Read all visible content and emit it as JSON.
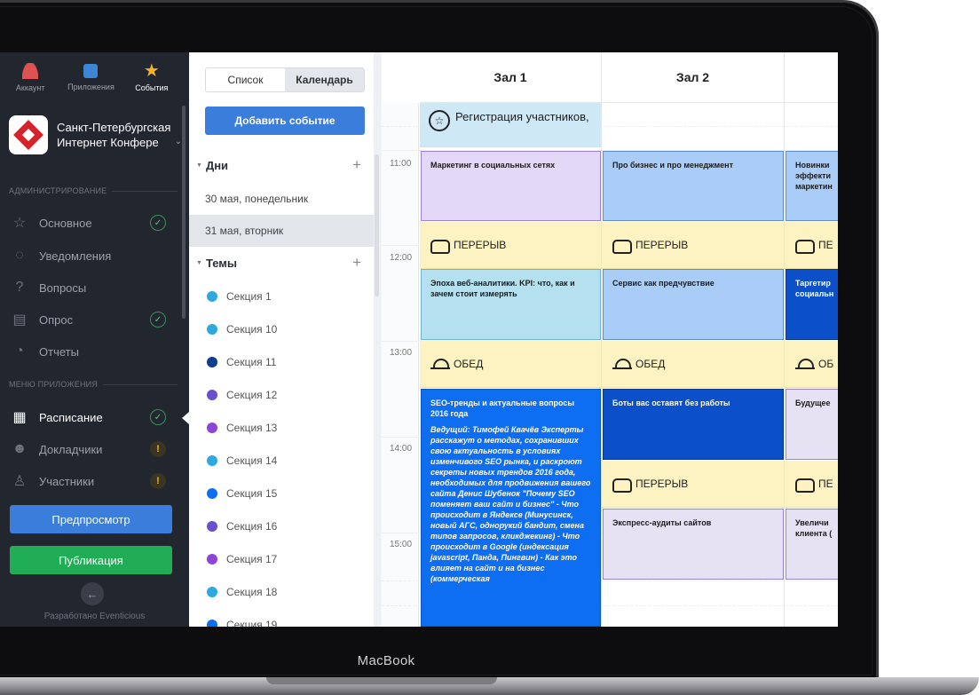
{
  "app": {
    "top_tabs": [
      {
        "label": "Аккаунт",
        "icon": "user-icon"
      },
      {
        "label": "Приложения",
        "icon": "apps-icon"
      },
      {
        "label": "События",
        "icon": "star-icon"
      }
    ],
    "org_name": "Санкт-Петербургская Интернет Конфере",
    "admin_section": "АДМИНИСТРИРОВАНИЕ",
    "admin_items": [
      {
        "label": "Основное",
        "icon": "star-outline-icon",
        "status": "ok"
      },
      {
        "label": "Уведомления",
        "icon": "chat-icon",
        "status": ""
      },
      {
        "label": "Вопросы",
        "icon": "question-icon",
        "status": ""
      },
      {
        "label": "Опрос",
        "icon": "survey-icon",
        "status": "ok"
      },
      {
        "label": "Отчеты",
        "icon": "reports-icon",
        "status": ""
      }
    ],
    "menu_section": "МЕНЮ ПРИЛОЖЕНИЯ",
    "menu_items": [
      {
        "label": "Расписание",
        "icon": "calendar-icon",
        "status": "ok"
      },
      {
        "label": "Докладчики",
        "icon": "speaker-icon",
        "status": "warn"
      },
      {
        "label": "Участники",
        "icon": "participants-icon",
        "status": "warn"
      }
    ],
    "preview_button": "Предпросмотр",
    "publish_button": "Публикация",
    "credit": "Разработано Eventicious",
    "check_glyph": "✓",
    "warn_glyph": "!"
  },
  "panel": {
    "view_list": "Список",
    "view_calendar": "Календарь",
    "add_event": "Добавить событие",
    "days_header": "Дни",
    "days": [
      "30 мая, понедельник",
      "31 мая, вторник"
    ],
    "themes_header": "Темы",
    "themes": [
      {
        "label": "Секция 1",
        "color": "#2ea8e0"
      },
      {
        "label": "Секция 10",
        "color": "#2ea8e0"
      },
      {
        "label": "Секция 11",
        "color": "#0b3d91"
      },
      {
        "label": "Секция 12",
        "color": "#6b4fd1"
      },
      {
        "label": "Секция 13",
        "color": "#8e44d6"
      },
      {
        "label": "Секция 14",
        "color": "#2ea8e0"
      },
      {
        "label": "Секция 15",
        "color": "#0e6ef2"
      },
      {
        "label": "Секция 16",
        "color": "#6b4fd1"
      },
      {
        "label": "Секция 17",
        "color": "#8e44d6"
      },
      {
        "label": "Секция 18",
        "color": "#2ea8e0"
      },
      {
        "label": "Секция 19",
        "color": "#0e6ef2"
      }
    ]
  },
  "schedule": {
    "halls": [
      "Зал 1",
      "Зал 2"
    ],
    "times": [
      "11:00",
      "12:00",
      "13:00",
      "14:00",
      "15:00"
    ],
    "registration": "Регистрация участников,",
    "break_label": "ПЕРЕРЫВ",
    "lunch_label": "ОБЕД",
    "break_cut": "ПЕ",
    "lunch_cut": "ОБ",
    "events": {
      "h1_a": "Маркетинг в социальных сетях",
      "h2_a": "Про бизнес и про менеджмент",
      "h3_a": "Новинки эффекти маркетин",
      "h1_b": "Эпоха веб-аналитики. KPI: что, как и зачем стоит измерять",
      "h2_b": "Сервис как предчувствие",
      "h3_b": "Таргетир социальн",
      "h1_c_title": "SEO-тренды и актуальные вопросы 2016 года",
      "h1_c_desc": "Ведущий: Тимофей Квачёв Эксперты расскажут о методах, сохранивших свою актуальность в условиях изменчивого SEO рынка, и раскроют секреты новых трендов 2016 года, необходимых для продвижения вашего сайта Денис Шубенок \"Почему SEO поменяет ваш сайт и бизнес\" - Что происходит в Яндексе (Минусинск, новый АГС, однорукий бандит, смена типов запросов, кликджекинг) - Что происходит в Google (индексация javascript, Панда, Пингвин) - Как это влияет на сайт и на бизнес (коммерческая",
      "h2_c": "Боты вас оставят без работы",
      "h3_c": "Будущее",
      "h2_d": "Экспресс-аудиты сайтов",
      "h3_d": "Увеличи клиента ("
    }
  },
  "device_label": "MacBook"
}
